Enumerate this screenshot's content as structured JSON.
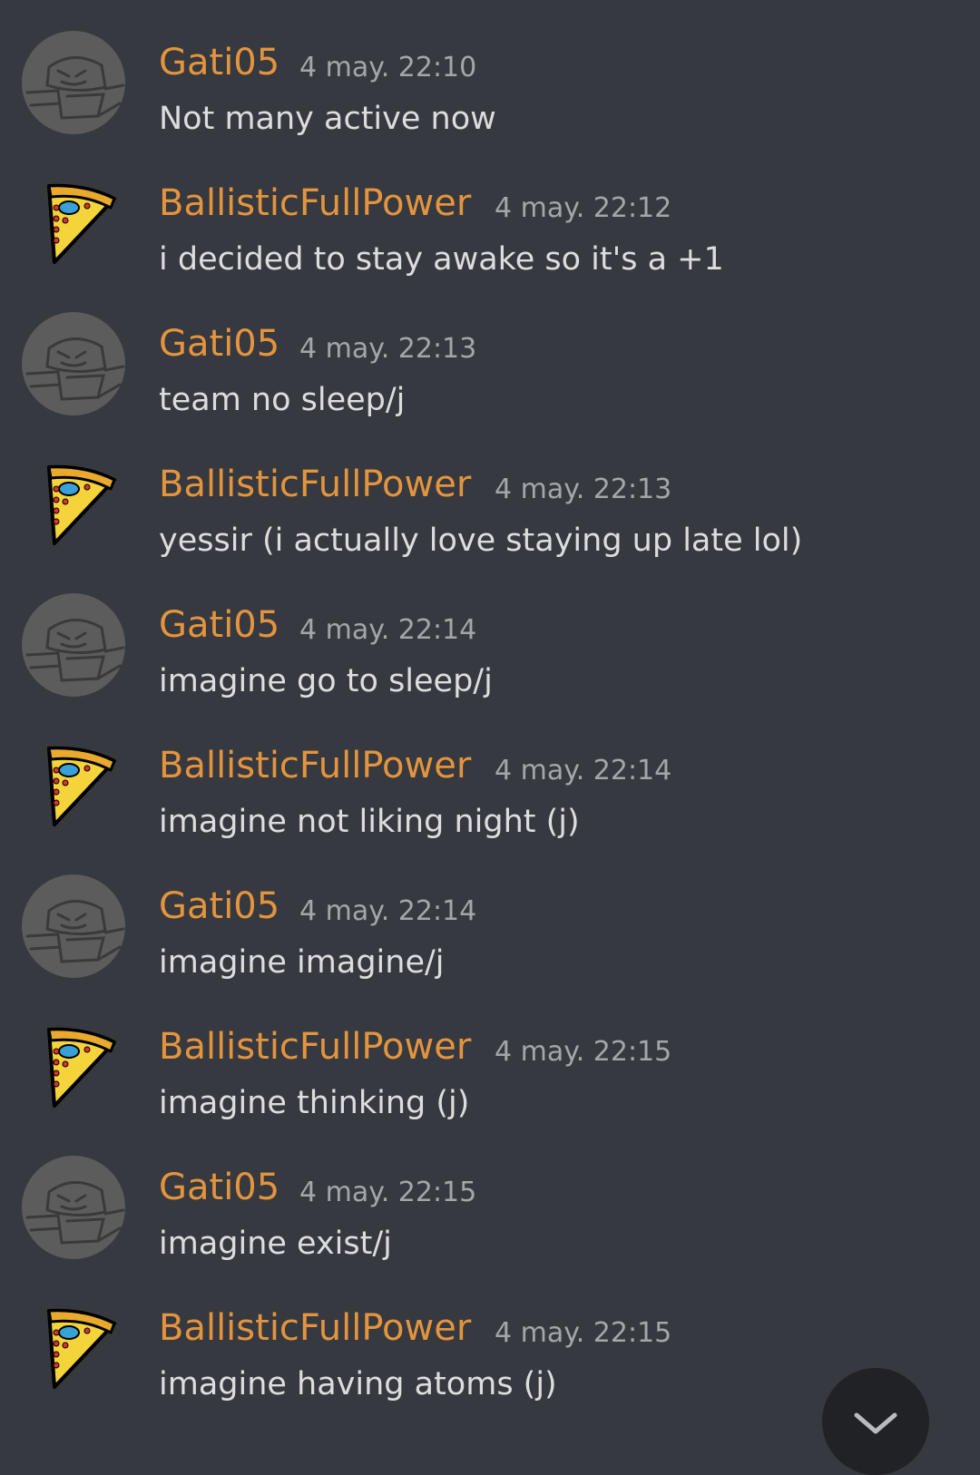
{
  "messages": [
    {
      "author": "Gati05",
      "avatar": "gati-avatar-icon",
      "timestamp": "4 may. 22:10",
      "content": "Not many active now"
    },
    {
      "author": "BallisticFullPower",
      "avatar": "pizza-avatar-icon",
      "timestamp": "4 may. 22:12",
      "content": "i decided to stay awake so it's a +1"
    },
    {
      "author": "Gati05",
      "avatar": "gati-avatar-icon",
      "timestamp": "4 may. 22:13",
      "content": "team no sleep/j"
    },
    {
      "author": "BallisticFullPower",
      "avatar": "pizza-avatar-icon",
      "timestamp": "4 may. 22:13",
      "content": "yessir (i actually love staying up late lol)"
    },
    {
      "author": "Gati05",
      "avatar": "gati-avatar-icon",
      "timestamp": "4 may. 22:14",
      "content": "imagine go to sleep/j"
    },
    {
      "author": "BallisticFullPower",
      "avatar": "pizza-avatar-icon",
      "timestamp": "4 may. 22:14",
      "content": "imagine not liking night (j)"
    },
    {
      "author": "Gati05",
      "avatar": "gati-avatar-icon",
      "timestamp": "4 may. 22:14",
      "content": "imagine imagine/j"
    },
    {
      "author": "BallisticFullPower",
      "avatar": "pizza-avatar-icon",
      "timestamp": "4 may. 22:15",
      "content": "imagine thinking (j)"
    },
    {
      "author": "Gati05",
      "avatar": "gati-avatar-icon",
      "timestamp": "4 may. 22:15",
      "content": "imagine exist/j"
    },
    {
      "author": "BallisticFullPower",
      "avatar": "pizza-avatar-icon",
      "timestamp": "4 may. 22:15",
      "content": "imagine having atoms (j)"
    }
  ],
  "jump_button": {
    "icon": "chevron-down-icon"
  },
  "colors": {
    "background": "#36393f",
    "author_name": "#e3943e",
    "timestamp": "#a3a6aa",
    "message_text": "#dcddde",
    "jump_button": "#202225"
  }
}
